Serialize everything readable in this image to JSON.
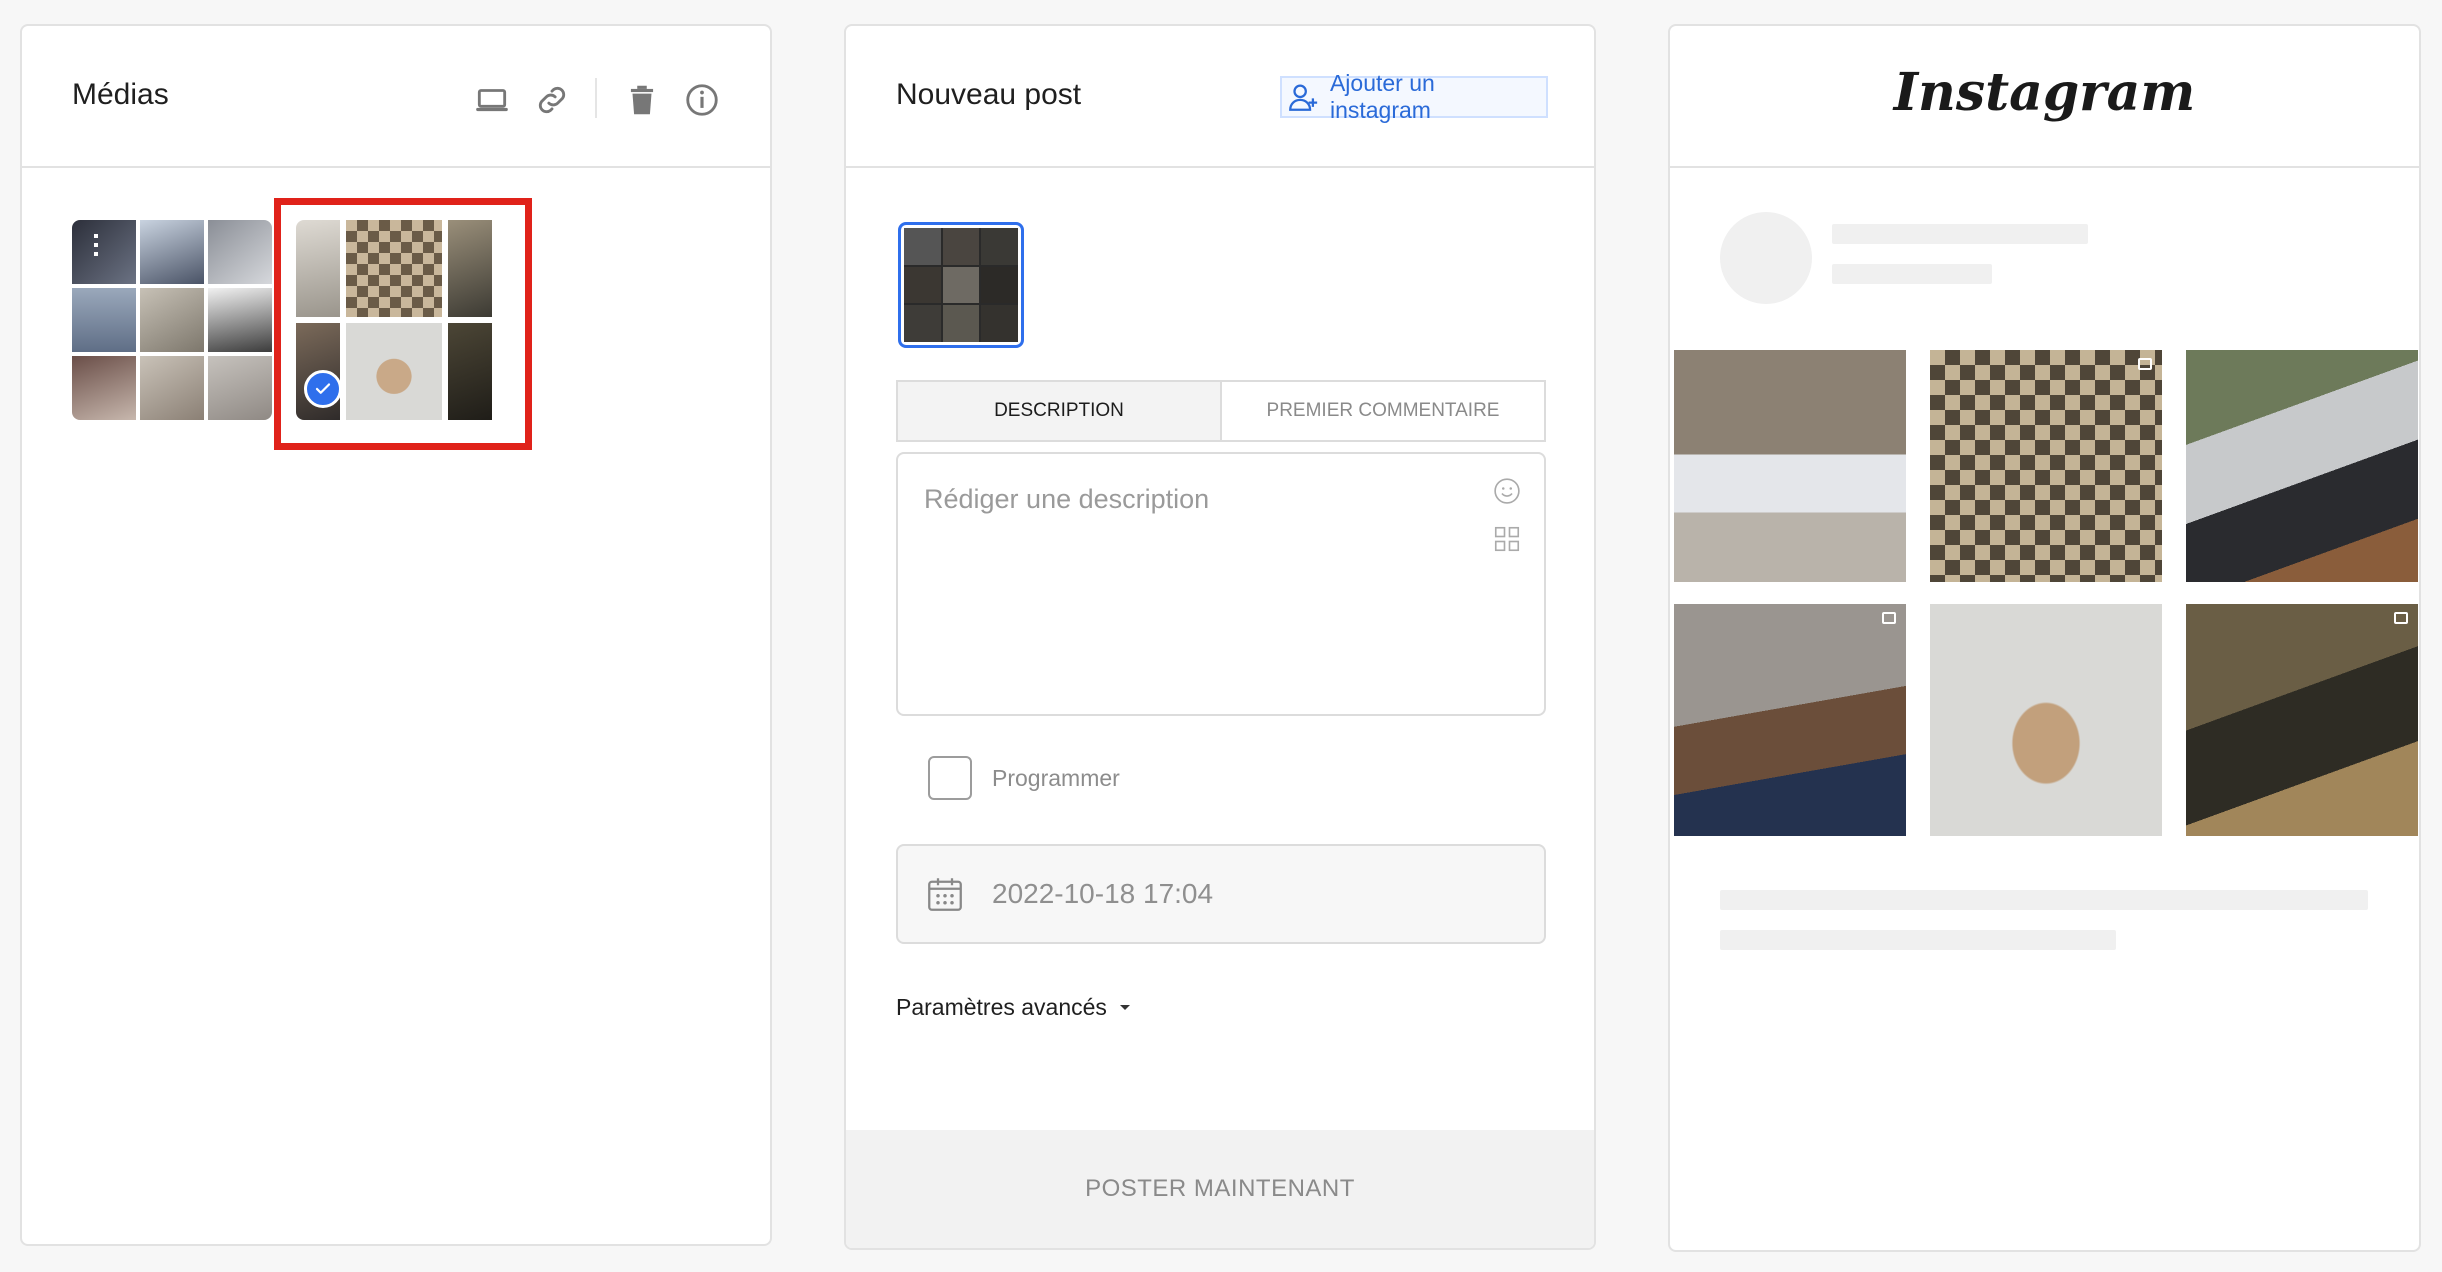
{
  "media_panel": {
    "title": "Médias",
    "toolbar": {
      "upload_icon": "laptop-icon",
      "link_icon": "link-icon",
      "delete_icon": "trash-icon",
      "info_icon": "info-icon"
    },
    "selected_group_index": 1
  },
  "post_panel": {
    "title": "Nouveau post",
    "add_account_label": "Ajouter un instagram",
    "tabs": [
      {
        "label": "DESCRIPTION",
        "active": true
      },
      {
        "label": "PREMIER COMMENTAIRE",
        "active": false
      }
    ],
    "description_placeholder": "Rédiger une description",
    "schedule_label": "Programmer",
    "schedule_checked": false,
    "date_value": "2022-10-18 17:04",
    "advanced_label": "Paramètres avancés",
    "post_button_label": "POSTER MAINTENANT"
  },
  "preview_panel": {
    "logo": "Instagram",
    "posts": 6
  },
  "colors": {
    "accent": "#2f6fec",
    "selection": "#e0221a",
    "link": "#2a6ad8"
  }
}
